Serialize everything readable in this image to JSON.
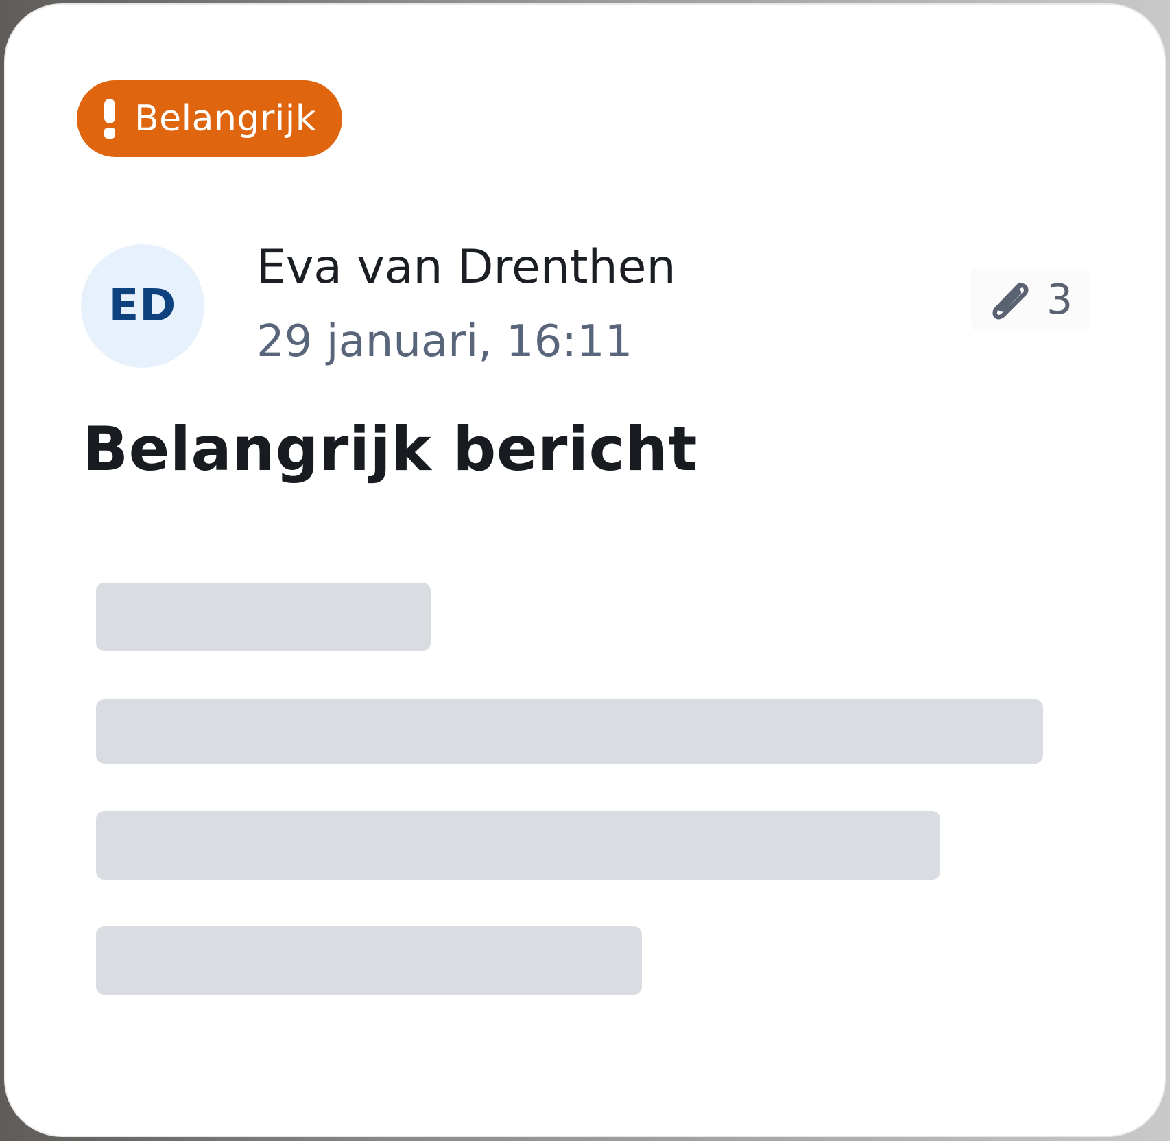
{
  "colors": {
    "badge_background": "#e0650f",
    "avatar_background": "#e7f1fb",
    "avatar_text": "#0d427e",
    "skeleton_fill": "#d9dde2"
  },
  "badge": {
    "icon": "exclamation-icon",
    "label": "Belangrijk"
  },
  "message": {
    "avatar_initials": "ED",
    "sender_name": "Eva van Drenthen",
    "timestamp": "29 januari, 16:11",
    "attachment": {
      "icon": "paperclip-icon",
      "count": "3"
    },
    "subject": "Belangrijk bericht"
  }
}
